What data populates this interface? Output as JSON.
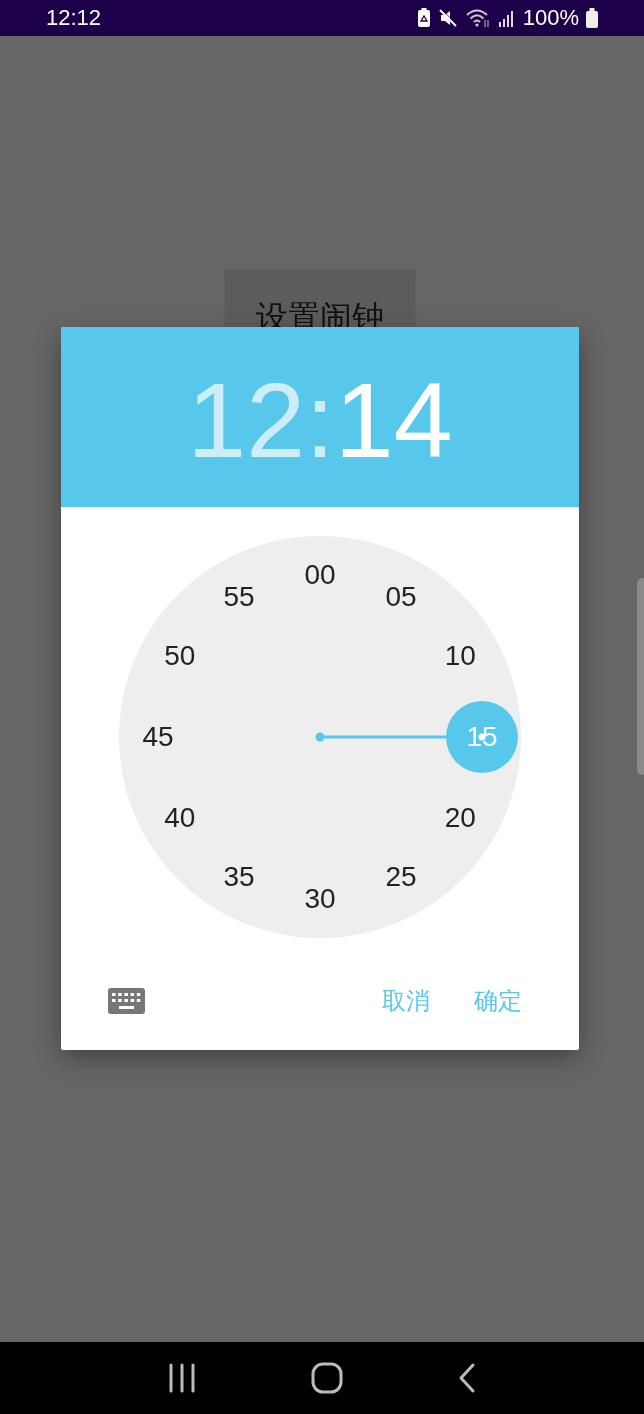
{
  "status_bar": {
    "time": "12:12",
    "battery": "100%"
  },
  "background_button": {
    "label": "设置闹钟"
  },
  "dialog": {
    "header": [
      {
        "text": "12",
        "selected": false
      },
      {
        "text": ":",
        "selected": false
      },
      {
        "text": "14",
        "selected": true
      }
    ],
    "dial": {
      "labels": [
        {
          "text": "00",
          "selected": false
        },
        {
          "text": "05",
          "selected": false
        },
        {
          "text": "10",
          "selected": false
        },
        {
          "text": "15",
          "selected": true
        },
        {
          "text": "20",
          "selected": false
        },
        {
          "text": "25",
          "selected": false
        },
        {
          "text": "30",
          "selected": false
        },
        {
          "text": "35",
          "selected": false
        },
        {
          "text": "40",
          "selected": false
        },
        {
          "text": "45",
          "selected": false
        },
        {
          "text": "50",
          "selected": false
        },
        {
          "text": "55",
          "selected": false
        }
      ]
    },
    "buttons": [
      "取消",
      "确定"
    ]
  }
}
